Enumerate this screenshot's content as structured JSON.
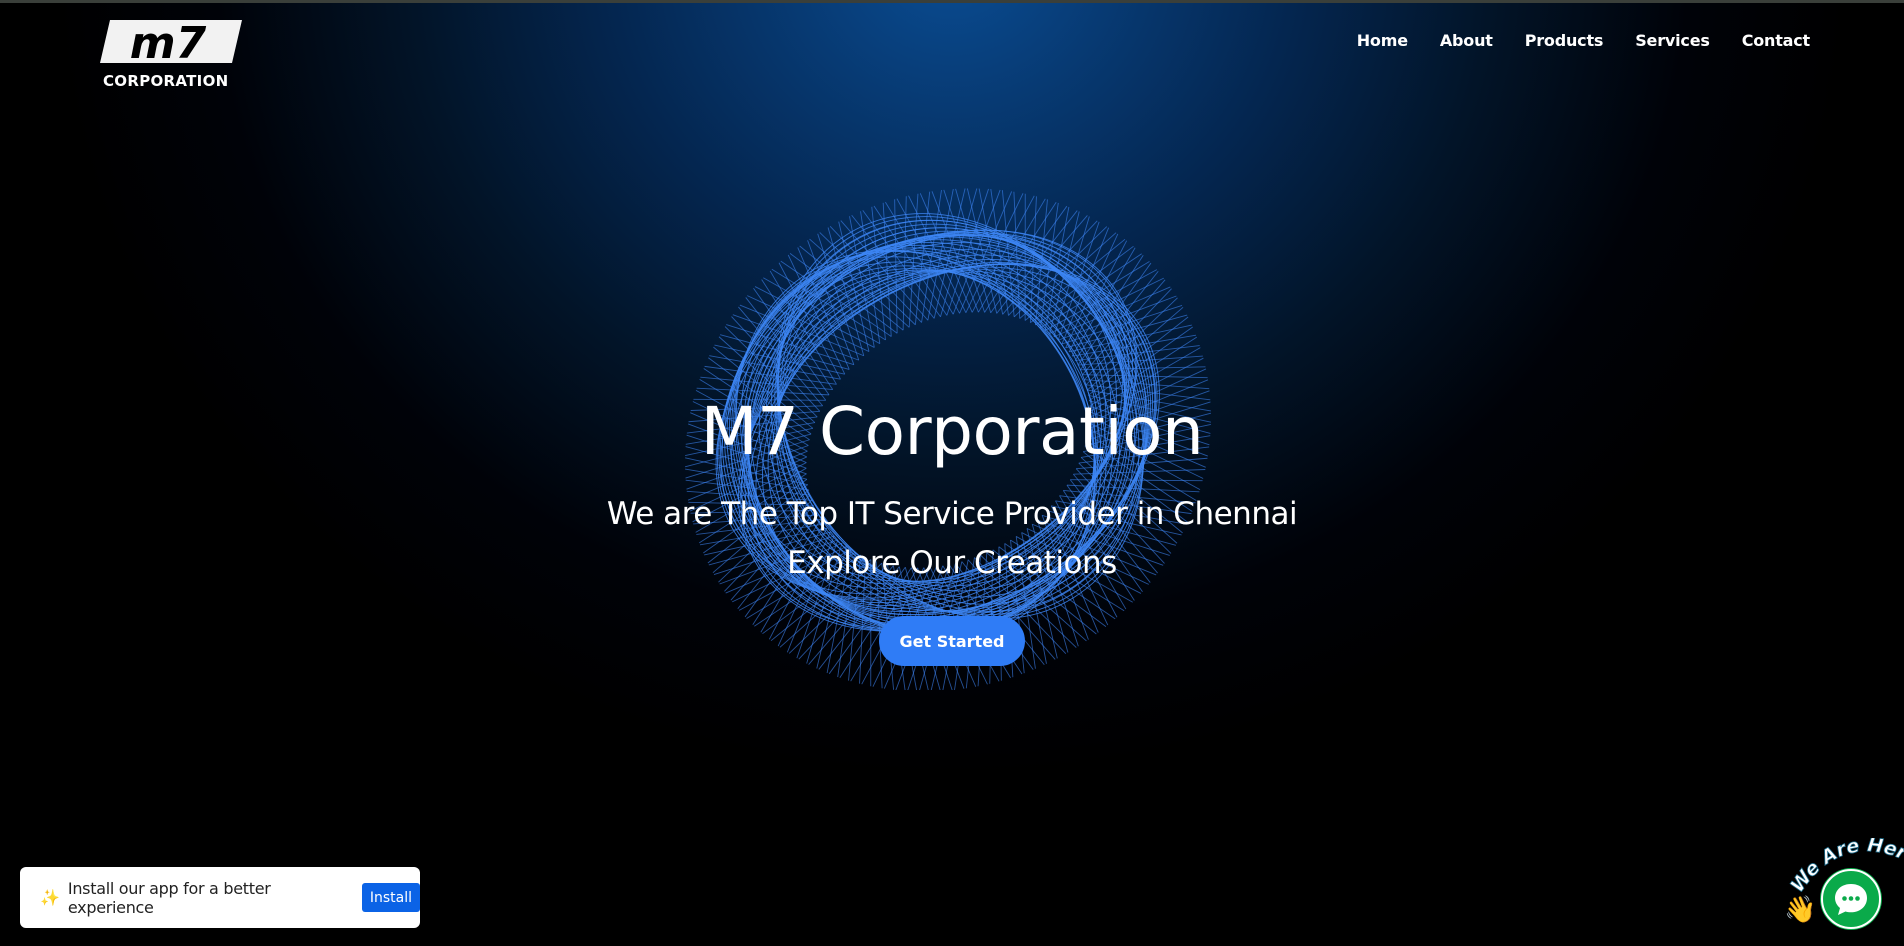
{
  "header": {
    "logo_mark": "m7",
    "logo_word": "CORPORATION",
    "nav": [
      "Home",
      "About",
      "Products",
      "Services",
      "Contact"
    ]
  },
  "hero": {
    "title": "M7 Corporation",
    "subtitle_line1": "We are The Top IT Service Provider in Chennai",
    "subtitle_line2": "Explore Our Creations",
    "cta_label": "Get Started",
    "torus_color": "#3d86f5"
  },
  "install_toast": {
    "icon": "sparkles-icon",
    "message": "Install our app for a better experience",
    "button_label": "Install"
  },
  "chat_widget": {
    "badge_text": "We Are Here!",
    "icon": "chat-bubble-icon",
    "accent": "#0aaa4a"
  },
  "colors": {
    "primary": "#2f7cf6",
    "install_button": "#0b63e6"
  }
}
